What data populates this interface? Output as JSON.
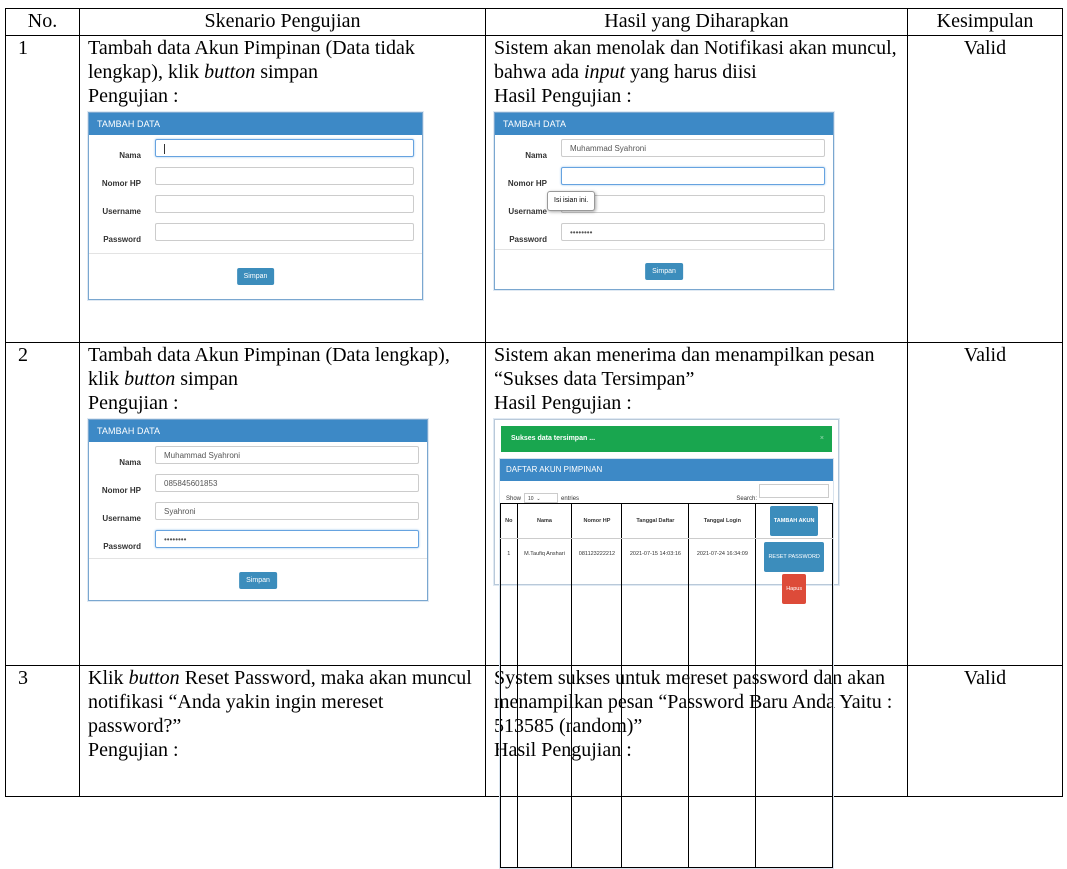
{
  "table": {
    "headers": [
      "No.",
      "Skenario Pengujian",
      "Hasil yang Diharapkan",
      "Kesimpulan"
    ],
    "rows": [
      {
        "no": "1",
        "skenario_a": "Tambah data Akun Pimpinan (Data tidak lengkap), klik ",
        "skenario_em": "button",
        "skenario_b": " simpan",
        "skenario_label": "Pengujian :",
        "harapan_a": "Sistem akan menolak dan Notifikasi akan muncul, bahwa ada ",
        "harapan_em": "input",
        "harapan_b": " yang harus diisi",
        "harapan_label": "Hasil Pengujian :",
        "kesimpulan": "Valid"
      },
      {
        "no": "2",
        "skenario_a": "Tambah data Akun Pimpinan (Data lengkap), klik ",
        "skenario_em": "button",
        "skenario_b": " simpan",
        "skenario_label": "Pengujian :",
        "harapan_a": "Sistem akan menerima dan menampilkan pesan “Sukses data Tersimpan”",
        "harapan_label": "Hasil Pengujian :",
        "kesimpulan": "Valid"
      },
      {
        "no": "3",
        "skenario_pre": "Klik ",
        "skenario_em": "button",
        "skenario_a": " Reset Password, maka akan muncul notifikasi “Anda yakin ingin mereset password?”",
        "skenario_label": "Pengujian :",
        "harapan_a": "System sukses untuk mereset password dan akan menampilkan pesan “Password Baru Anda Yaitu : 513585 (random)”",
        "harapan_label": "Hasil Pengujian :",
        "kesimpulan": "Valid"
      }
    ]
  },
  "form": {
    "header": "TAMBAH DATA",
    "labels": [
      "Nama",
      "Nomor HP",
      "Username",
      "Password"
    ],
    "button": "Simpan"
  },
  "shot_1_result": {
    "nama": "Muhammad Syahroni",
    "password": "••••••••",
    "tooltip": "Isi isian ini."
  },
  "shot_2_test": {
    "nama": "Muhammad Syahroni",
    "nomor_hp": "085845601853",
    "username": "Syahroni",
    "password": "••••••••"
  },
  "shot_2_result": {
    "alert": "Sukses data tersimpan ...",
    "close": "×",
    "panel_title": "DAFTAR AKUN PIMPINAN",
    "show": "Show",
    "entries_value": "10",
    "entries": "entries",
    "search": "Search:",
    "columns": [
      "No",
      "Nama",
      "Nomor HP",
      "Tanggal Daftar",
      "Tanggal Login"
    ],
    "add_button": "TAMBAH AKUN",
    "row": {
      "no": "1",
      "nama": "M.Taufiq Anshari",
      "hp": "081123222212",
      "daftar": "2021-07-15 14:03:16",
      "login": "2021-07-24 16:34:09"
    },
    "reset_button": "RESET PASSWORD",
    "delete_button": "Hapus"
  },
  "colors": {
    "header_blue": "#3d89c6",
    "success_green": "#19a64f",
    "danger_red": "#dd4b39"
  }
}
